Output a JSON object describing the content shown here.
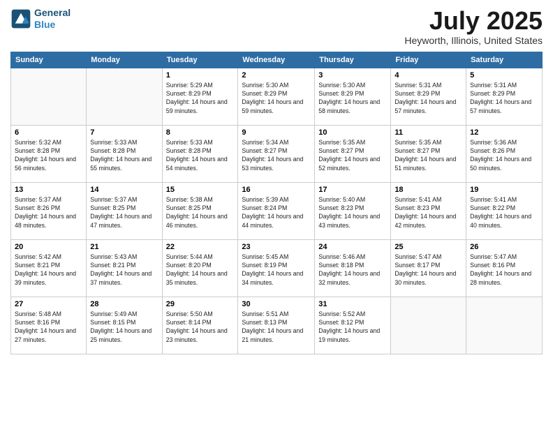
{
  "header": {
    "logo_line1": "General",
    "logo_line2": "Blue",
    "title": "July 2025",
    "subtitle": "Heyworth, Illinois, United States"
  },
  "weekdays": [
    "Sunday",
    "Monday",
    "Tuesday",
    "Wednesday",
    "Thursday",
    "Friday",
    "Saturday"
  ],
  "weeks": [
    [
      {
        "day": "",
        "info": ""
      },
      {
        "day": "",
        "info": ""
      },
      {
        "day": "1",
        "info": "Sunrise: 5:29 AM\nSunset: 8:29 PM\nDaylight: 14 hours and 59 minutes."
      },
      {
        "day": "2",
        "info": "Sunrise: 5:30 AM\nSunset: 8:29 PM\nDaylight: 14 hours and 59 minutes."
      },
      {
        "day": "3",
        "info": "Sunrise: 5:30 AM\nSunset: 8:29 PM\nDaylight: 14 hours and 58 minutes."
      },
      {
        "day": "4",
        "info": "Sunrise: 5:31 AM\nSunset: 8:29 PM\nDaylight: 14 hours and 57 minutes."
      },
      {
        "day": "5",
        "info": "Sunrise: 5:31 AM\nSunset: 8:29 PM\nDaylight: 14 hours and 57 minutes."
      }
    ],
    [
      {
        "day": "6",
        "info": "Sunrise: 5:32 AM\nSunset: 8:28 PM\nDaylight: 14 hours and 56 minutes."
      },
      {
        "day": "7",
        "info": "Sunrise: 5:33 AM\nSunset: 8:28 PM\nDaylight: 14 hours and 55 minutes."
      },
      {
        "day": "8",
        "info": "Sunrise: 5:33 AM\nSunset: 8:28 PM\nDaylight: 14 hours and 54 minutes."
      },
      {
        "day": "9",
        "info": "Sunrise: 5:34 AM\nSunset: 8:27 PM\nDaylight: 14 hours and 53 minutes."
      },
      {
        "day": "10",
        "info": "Sunrise: 5:35 AM\nSunset: 8:27 PM\nDaylight: 14 hours and 52 minutes."
      },
      {
        "day": "11",
        "info": "Sunrise: 5:35 AM\nSunset: 8:27 PM\nDaylight: 14 hours and 51 minutes."
      },
      {
        "day": "12",
        "info": "Sunrise: 5:36 AM\nSunset: 8:26 PM\nDaylight: 14 hours and 50 minutes."
      }
    ],
    [
      {
        "day": "13",
        "info": "Sunrise: 5:37 AM\nSunset: 8:26 PM\nDaylight: 14 hours and 48 minutes."
      },
      {
        "day": "14",
        "info": "Sunrise: 5:37 AM\nSunset: 8:25 PM\nDaylight: 14 hours and 47 minutes."
      },
      {
        "day": "15",
        "info": "Sunrise: 5:38 AM\nSunset: 8:25 PM\nDaylight: 14 hours and 46 minutes."
      },
      {
        "day": "16",
        "info": "Sunrise: 5:39 AM\nSunset: 8:24 PM\nDaylight: 14 hours and 44 minutes."
      },
      {
        "day": "17",
        "info": "Sunrise: 5:40 AM\nSunset: 8:23 PM\nDaylight: 14 hours and 43 minutes."
      },
      {
        "day": "18",
        "info": "Sunrise: 5:41 AM\nSunset: 8:23 PM\nDaylight: 14 hours and 42 minutes."
      },
      {
        "day": "19",
        "info": "Sunrise: 5:41 AM\nSunset: 8:22 PM\nDaylight: 14 hours and 40 minutes."
      }
    ],
    [
      {
        "day": "20",
        "info": "Sunrise: 5:42 AM\nSunset: 8:21 PM\nDaylight: 14 hours and 39 minutes."
      },
      {
        "day": "21",
        "info": "Sunrise: 5:43 AM\nSunset: 8:21 PM\nDaylight: 14 hours and 37 minutes."
      },
      {
        "day": "22",
        "info": "Sunrise: 5:44 AM\nSunset: 8:20 PM\nDaylight: 14 hours and 35 minutes."
      },
      {
        "day": "23",
        "info": "Sunrise: 5:45 AM\nSunset: 8:19 PM\nDaylight: 14 hours and 34 minutes."
      },
      {
        "day": "24",
        "info": "Sunrise: 5:46 AM\nSunset: 8:18 PM\nDaylight: 14 hours and 32 minutes."
      },
      {
        "day": "25",
        "info": "Sunrise: 5:47 AM\nSunset: 8:17 PM\nDaylight: 14 hours and 30 minutes."
      },
      {
        "day": "26",
        "info": "Sunrise: 5:47 AM\nSunset: 8:16 PM\nDaylight: 14 hours and 28 minutes."
      }
    ],
    [
      {
        "day": "27",
        "info": "Sunrise: 5:48 AM\nSunset: 8:16 PM\nDaylight: 14 hours and 27 minutes."
      },
      {
        "day": "28",
        "info": "Sunrise: 5:49 AM\nSunset: 8:15 PM\nDaylight: 14 hours and 25 minutes."
      },
      {
        "day": "29",
        "info": "Sunrise: 5:50 AM\nSunset: 8:14 PM\nDaylight: 14 hours and 23 minutes."
      },
      {
        "day": "30",
        "info": "Sunrise: 5:51 AM\nSunset: 8:13 PM\nDaylight: 14 hours and 21 minutes."
      },
      {
        "day": "31",
        "info": "Sunrise: 5:52 AM\nSunset: 8:12 PM\nDaylight: 14 hours and 19 minutes."
      },
      {
        "day": "",
        "info": ""
      },
      {
        "day": "",
        "info": ""
      }
    ]
  ]
}
